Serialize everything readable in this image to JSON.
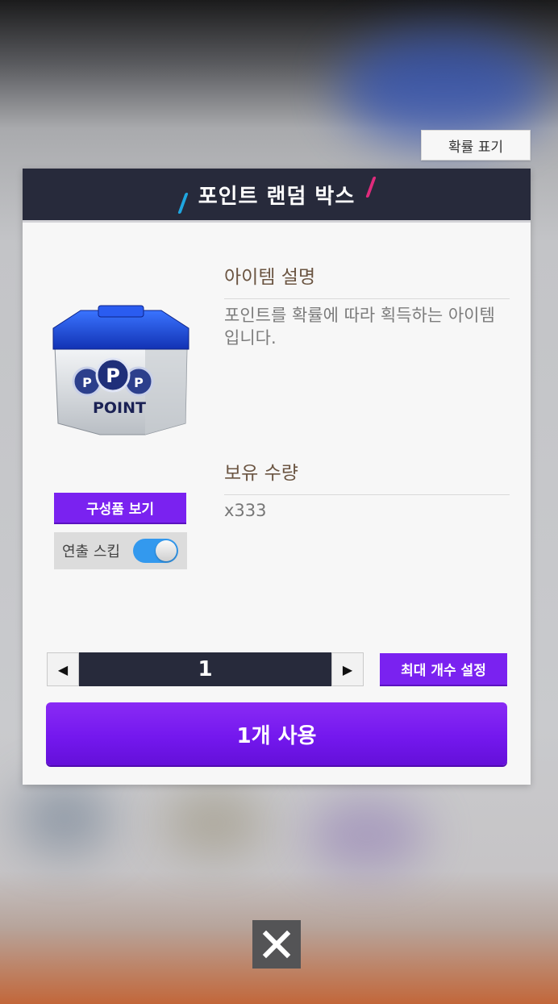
{
  "probability_button": {
    "label": "확률 표기"
  },
  "dialog": {
    "title": "포인트 랜덤 박스",
    "item": {
      "image_text": "POINT",
      "image_icon": "point-box-icon"
    },
    "description": {
      "heading": "아이템 설명",
      "text": "포인트를 확률에 따라 획득하는 아이템입니다."
    },
    "owned": {
      "heading": "보유 수량",
      "value": "x333"
    },
    "contents_button": {
      "label": "구성품 보기"
    },
    "skip": {
      "label": "연출 스킵",
      "enabled": true
    },
    "stepper": {
      "value": "1",
      "left_icon": "triangle-left-icon",
      "right_icon": "triangle-right-icon"
    },
    "max_button": {
      "label": "최대 개수 설정"
    },
    "use_button": {
      "label": "1개 사용"
    }
  },
  "close_button": {
    "icon": "close-icon"
  },
  "colors": {
    "header": "#272a3b",
    "accent_purple": "#7a22f0",
    "toggle_blue": "#3399ee",
    "slash_blue": "#1fa6e0",
    "slash_pink": "#e02b7c"
  }
}
